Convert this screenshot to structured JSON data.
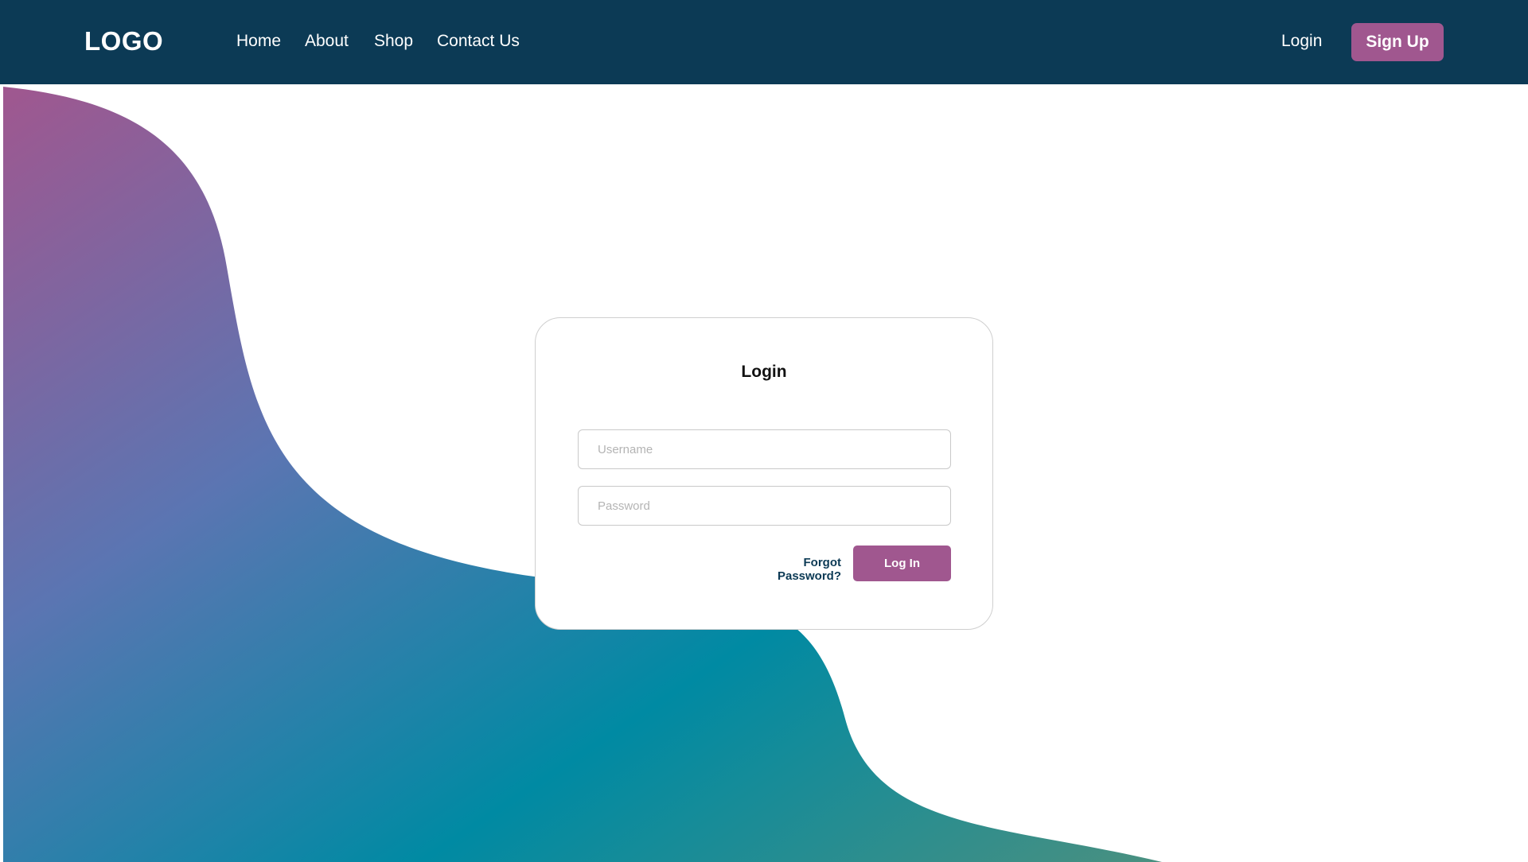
{
  "header": {
    "logo": "LOGO",
    "nav": {
      "home": "Home",
      "about": "About",
      "shop": "Shop",
      "contact": "Contact Us"
    },
    "login": "Login",
    "signup": "Sign Up"
  },
  "login_card": {
    "title": "Login",
    "username_placeholder": "Username",
    "password_placeholder": "Password",
    "forgot": "Forgot Password?",
    "submit": "Log In"
  },
  "colors": {
    "navbar": "#0c3a55",
    "accent": "#a0578f",
    "wave_top": "#a0578f",
    "wave_mid": "#3d7fb1",
    "wave_teal": "#008aa3",
    "wave_end": "#3a8f87"
  }
}
